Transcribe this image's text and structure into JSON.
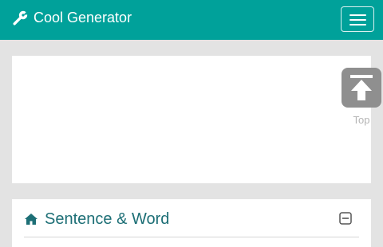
{
  "navbar": {
    "brand_icon": "wrench-icon",
    "brand_label": "Cool Generator",
    "menu_icon": "hamburger-menu-icon",
    "background_color": "#00a19a"
  },
  "scroll_top": {
    "icon": "arrow-to-top-icon",
    "label": "Top"
  },
  "section": {
    "icon": "home-icon",
    "title": "Sentence & Word",
    "collapse_icon": "minus-square-icon",
    "title_color": "#1d6f76"
  }
}
